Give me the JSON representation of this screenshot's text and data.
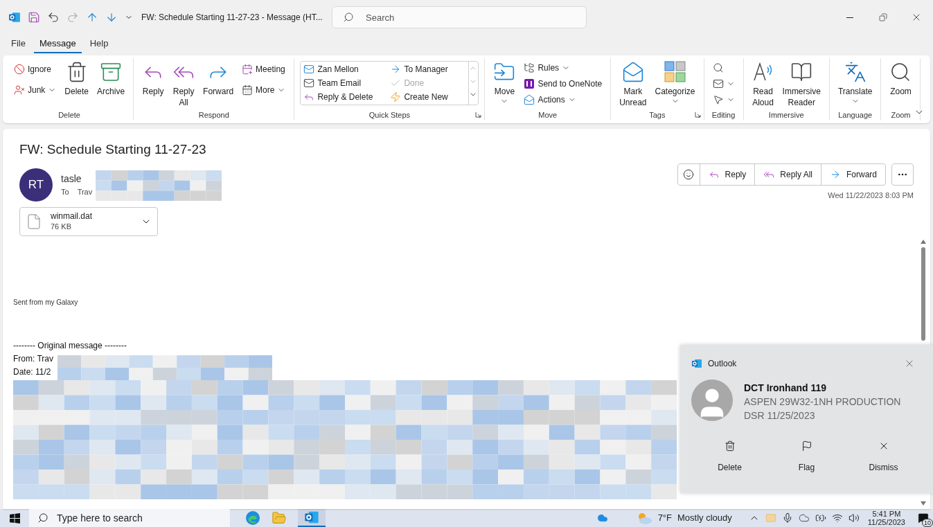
{
  "title_bar": {
    "title": "FW: Schedule Starting 11-27-23  -  Message (HT...",
    "search": {
      "placeholder": "Search"
    }
  },
  "menu_tabs": [
    {
      "label": "File",
      "selected": false
    },
    {
      "label": "Message",
      "selected": true
    },
    {
      "label": "Help",
      "selected": false
    }
  ],
  "ribbon": {
    "groups": [
      {
        "label": "Delete",
        "kind": "buttons",
        "launcher": false,
        "items": [
          {
            "label": "Ignore",
            "kind": "small",
            "menu": false
          },
          {
            "label": "Junk",
            "kind": "small",
            "menu": true
          },
          {
            "label": "Delete",
            "kind": "large",
            "menu": false
          },
          {
            "label": "Archive",
            "kind": "large",
            "menu": false
          }
        ]
      },
      {
        "label": "Respond",
        "kind": "buttons",
        "launcher": false,
        "items": [
          {
            "label": "Reply",
            "kind": "large",
            "menu": false
          },
          {
            "label": "Reply All",
            "kind": "large",
            "menu": false
          },
          {
            "label": "Forward",
            "kind": "large",
            "menu": false
          },
          {
            "label": "Meeting",
            "kind": "small",
            "menu": false
          },
          {
            "label": "More",
            "kind": "small",
            "menu": true
          }
        ]
      },
      {
        "label": "Quick Steps",
        "kind": "gallery",
        "launcher": true,
        "items": [
          {
            "label": "Zan Mellon",
            "disabled": false
          },
          {
            "label": "To Manager",
            "disabled": false
          },
          {
            "label": "Team Email",
            "disabled": false
          },
          {
            "label": "Done",
            "disabled": true
          },
          {
            "label": "Reply & Delete",
            "disabled": false
          },
          {
            "label": "Create New",
            "disabled": false
          }
        ]
      },
      {
        "label": "Move",
        "kind": "buttons",
        "launcher": false,
        "items": [
          {
            "label": "Move",
            "kind": "large",
            "menu": true
          },
          {
            "label": "Rules",
            "kind": "small",
            "menu": true
          },
          {
            "label": "Send to OneNote",
            "kind": "small",
            "menu": false
          },
          {
            "label": "Actions",
            "kind": "small",
            "menu": true
          }
        ]
      },
      {
        "label": "Tags",
        "kind": "buttons",
        "launcher": true,
        "items": [
          {
            "label": "Mark Unread",
            "kind": "large",
            "menu": false
          },
          {
            "label": "Categorize",
            "kind": "large",
            "menu": true
          }
        ]
      },
      {
        "label": "Editing",
        "kind": "buttons",
        "launcher": false,
        "items": [
          {
            "kind": "small",
            "menu": false
          },
          {
            "kind": "small",
            "menu": true
          },
          {
            "kind": "small",
            "menu": true
          }
        ]
      },
      {
        "label": "Immersive",
        "kind": "buttons",
        "launcher": false,
        "items": [
          {
            "label": "Read Aloud",
            "kind": "large",
            "menu": false
          },
          {
            "label": "Immersive Reader",
            "kind": "large",
            "menu": false
          }
        ]
      },
      {
        "label": "Language",
        "kind": "buttons",
        "launcher": false,
        "items": [
          {
            "label": "Translate",
            "kind": "large",
            "menu": true
          }
        ]
      },
      {
        "label": "Zoom",
        "kind": "buttons",
        "launcher": false,
        "items": [
          {
            "label": "Zoom",
            "kind": "large",
            "menu": false
          }
        ]
      }
    ]
  },
  "message": {
    "subject": "FW: Schedule Starting 11-27-23",
    "sender": {
      "initials": "RT",
      "name": "tasle",
      "to_label": "To",
      "to": "Trav"
    },
    "attachment": {
      "name": "winmail.dat",
      "size": "76 KB"
    },
    "actions": [
      {
        "label": "Reply"
      },
      {
        "label": "Reply All"
      },
      {
        "label": "Forward"
      }
    ],
    "date": "Wed 11/22/2023 8:03 PM",
    "body": [
      {
        "kind": "small",
        "text": "Sent from my Galaxy"
      },
      {
        "kind": "normal",
        "text": "-------- Original message --------"
      },
      {
        "kind": "normal",
        "text": "From: Trav"
      },
      {
        "kind": "normal",
        "text": "Date: 11/2"
      }
    ]
  },
  "notification": {
    "app": "Outlook",
    "title": "DCT Ironhand 119",
    "lines": [
      "ASPEN 29W32-1NH PRODUCTION",
      "DSR 11/25/2023"
    ],
    "actions": [
      "Delete",
      "Flag",
      "Dismiss"
    ]
  },
  "taskbar": {
    "search": {
      "placeholder": "Type here to search"
    },
    "temperature": "7°F",
    "weather": "Mostly cloudy",
    "time": "5:41 PM",
    "date": "11/25/2023",
    "notification_count": "10"
  }
}
